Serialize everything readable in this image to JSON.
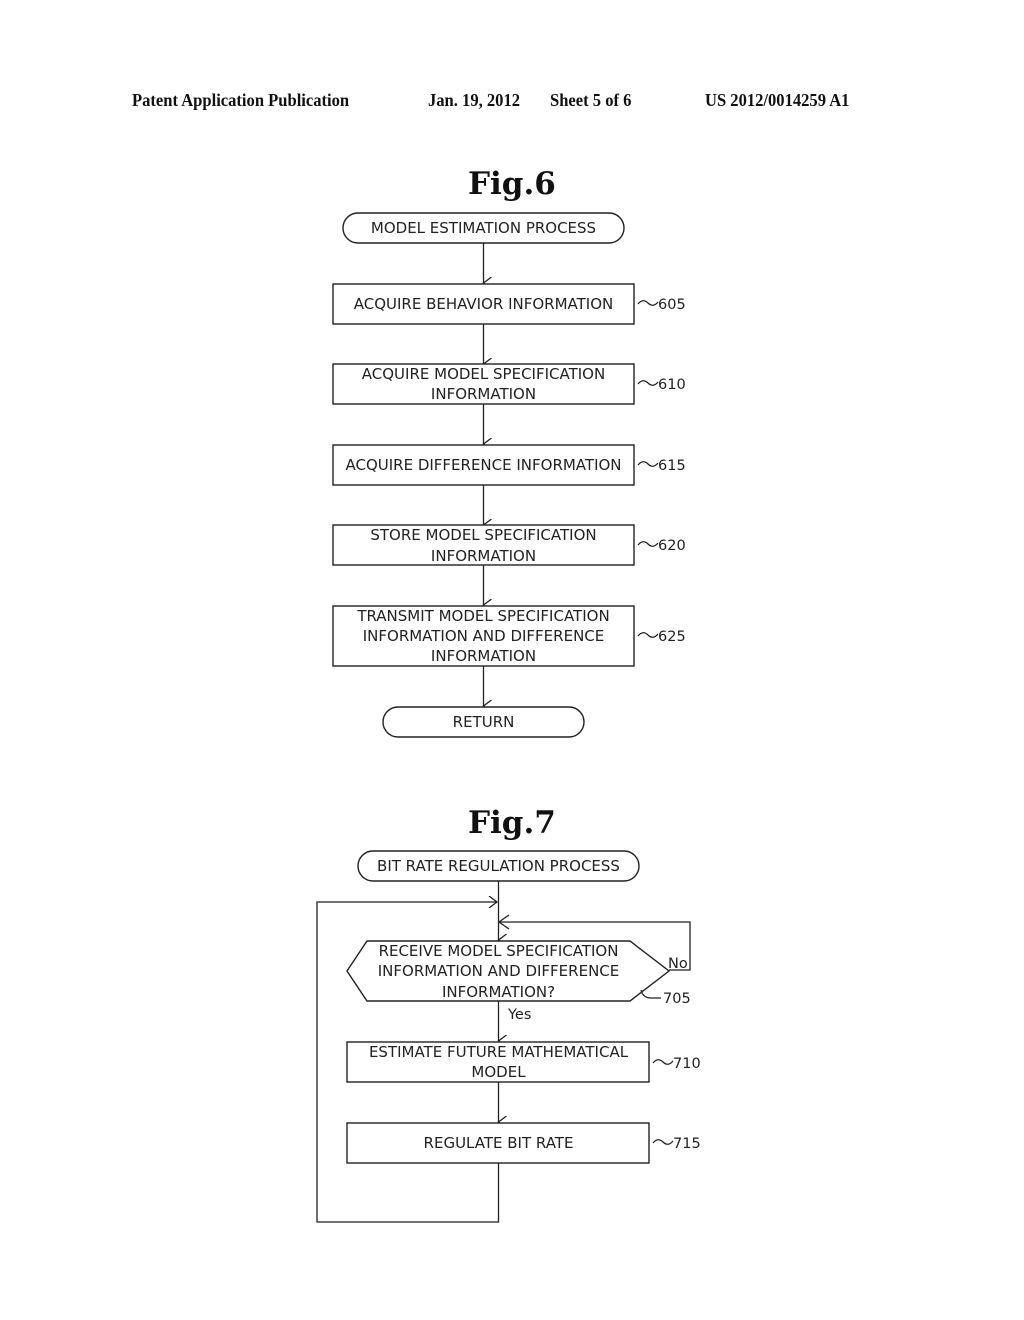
{
  "header": {
    "publication": "Patent Application Publication",
    "date": "Jan. 19, 2012",
    "sheet": "Sheet 5 of 6",
    "number": "US 2012/0014259 A1"
  },
  "fig6": {
    "title": "Fig.6",
    "start": "MODEL ESTIMATION PROCESS",
    "steps": [
      {
        "ref": "605",
        "lines": [
          "ACQUIRE BEHAVIOR INFORMATION"
        ]
      },
      {
        "ref": "610",
        "lines": [
          "ACQUIRE MODEL SPECIFICATION",
          "INFORMATION"
        ]
      },
      {
        "ref": "615",
        "lines": [
          "ACQUIRE DIFFERENCE INFORMATION"
        ]
      },
      {
        "ref": "620",
        "lines": [
          "STORE MODEL SPECIFICATION",
          "INFORMATION"
        ]
      },
      {
        "ref": "625",
        "lines": [
          "TRANSMIT MODEL SPECIFICATION",
          "INFORMATION AND DIFFERENCE",
          "INFORMATION"
        ]
      }
    ],
    "end": "RETURN"
  },
  "fig7": {
    "title": "Fig.7",
    "start": "BIT RATE REGULATION PROCESS",
    "decision": {
      "ref": "705",
      "lines": [
        "RECEIVE MODEL SPECIFICATION",
        "INFORMATION AND DIFFERENCE",
        "INFORMATION?"
      ],
      "yes": "Yes",
      "no": "No"
    },
    "steps": [
      {
        "ref": "710",
        "lines": [
          "ESTIMATE FUTURE MATHEMATICAL",
          "MODEL"
        ]
      },
      {
        "ref": "715",
        "lines": [
          "REGULATE BIT RATE"
        ]
      }
    ]
  }
}
